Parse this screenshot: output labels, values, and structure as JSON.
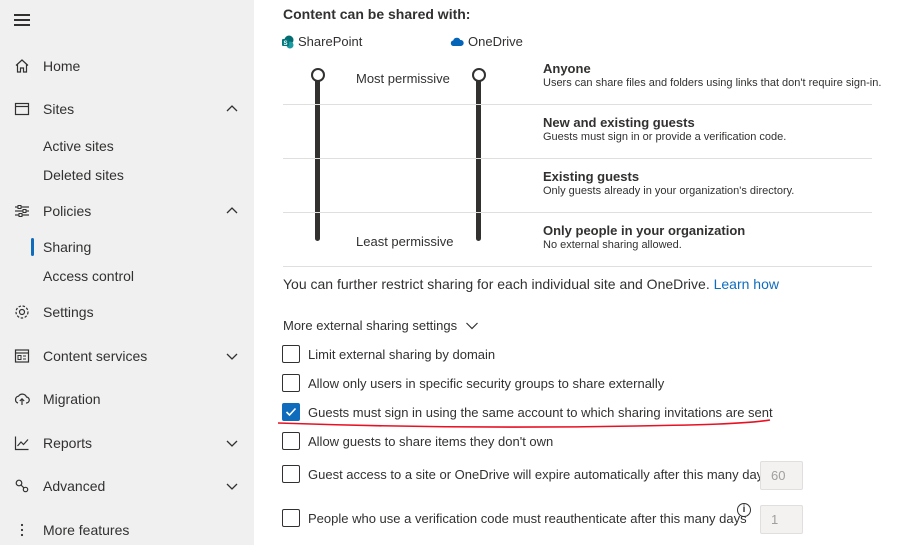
{
  "sidebar": {
    "items": [
      {
        "label": "Home",
        "icon": "home-icon"
      },
      {
        "label": "Sites",
        "icon": "sites-icon",
        "expanded": true
      },
      {
        "label": "Active sites"
      },
      {
        "label": "Deleted sites"
      },
      {
        "label": "Policies",
        "icon": "policies-icon",
        "expanded": true
      },
      {
        "label": "Sharing",
        "selected": true
      },
      {
        "label": "Access control"
      },
      {
        "label": "Settings",
        "icon": "gear-icon"
      },
      {
        "label": "Content services",
        "icon": "content-services-icon",
        "expanded": false
      },
      {
        "label": "Migration",
        "icon": "migration-icon"
      },
      {
        "label": "Reports",
        "icon": "reports-icon",
        "expanded": false
      },
      {
        "label": "Advanced",
        "icon": "advanced-icon",
        "expanded": false
      },
      {
        "label": "More features",
        "icon": "more-icon"
      }
    ]
  },
  "main": {
    "section_title": "Content can be shared with:",
    "sharepoint_label": "SharePoint",
    "onedrive_label": "OneDrive",
    "most_permissive": "Most permissive",
    "least_permissive": "Least permissive",
    "levels": [
      {
        "title": "Anyone",
        "desc": "Users can share files and folders using links that don't require sign-in."
      },
      {
        "title": "New and existing guests",
        "desc": "Guests must sign in or provide a verification code."
      },
      {
        "title": "Existing guests",
        "desc": "Only guests already in your organization's directory."
      },
      {
        "title": "Only people in your organization",
        "desc": "No external sharing allowed."
      }
    ],
    "info_text": "You can further restrict sharing for each individual site and OneDrive.",
    "learn_how": "Learn how",
    "more_settings_label": "More external sharing settings",
    "options": [
      {
        "label": "Limit external sharing by domain",
        "checked": false
      },
      {
        "label": "Allow only users in specific security groups to share externally",
        "checked": false
      },
      {
        "label": "Guests must sign in using the same account to which sharing invitations are sent",
        "checked": true
      },
      {
        "label": "Allow guests to share items they don't own",
        "checked": false
      },
      {
        "label": "Guest access to a site or OneDrive will expire automatically after this many days",
        "checked": false,
        "value": "60"
      },
      {
        "label": "People who use a verification code must reauthenticate after this many days",
        "checked": false,
        "value": "1"
      }
    ]
  },
  "colors": {
    "accent": "#0f6cbd",
    "sidebar_bg": "#f0f0f0",
    "annotation_red": "#e81123"
  }
}
